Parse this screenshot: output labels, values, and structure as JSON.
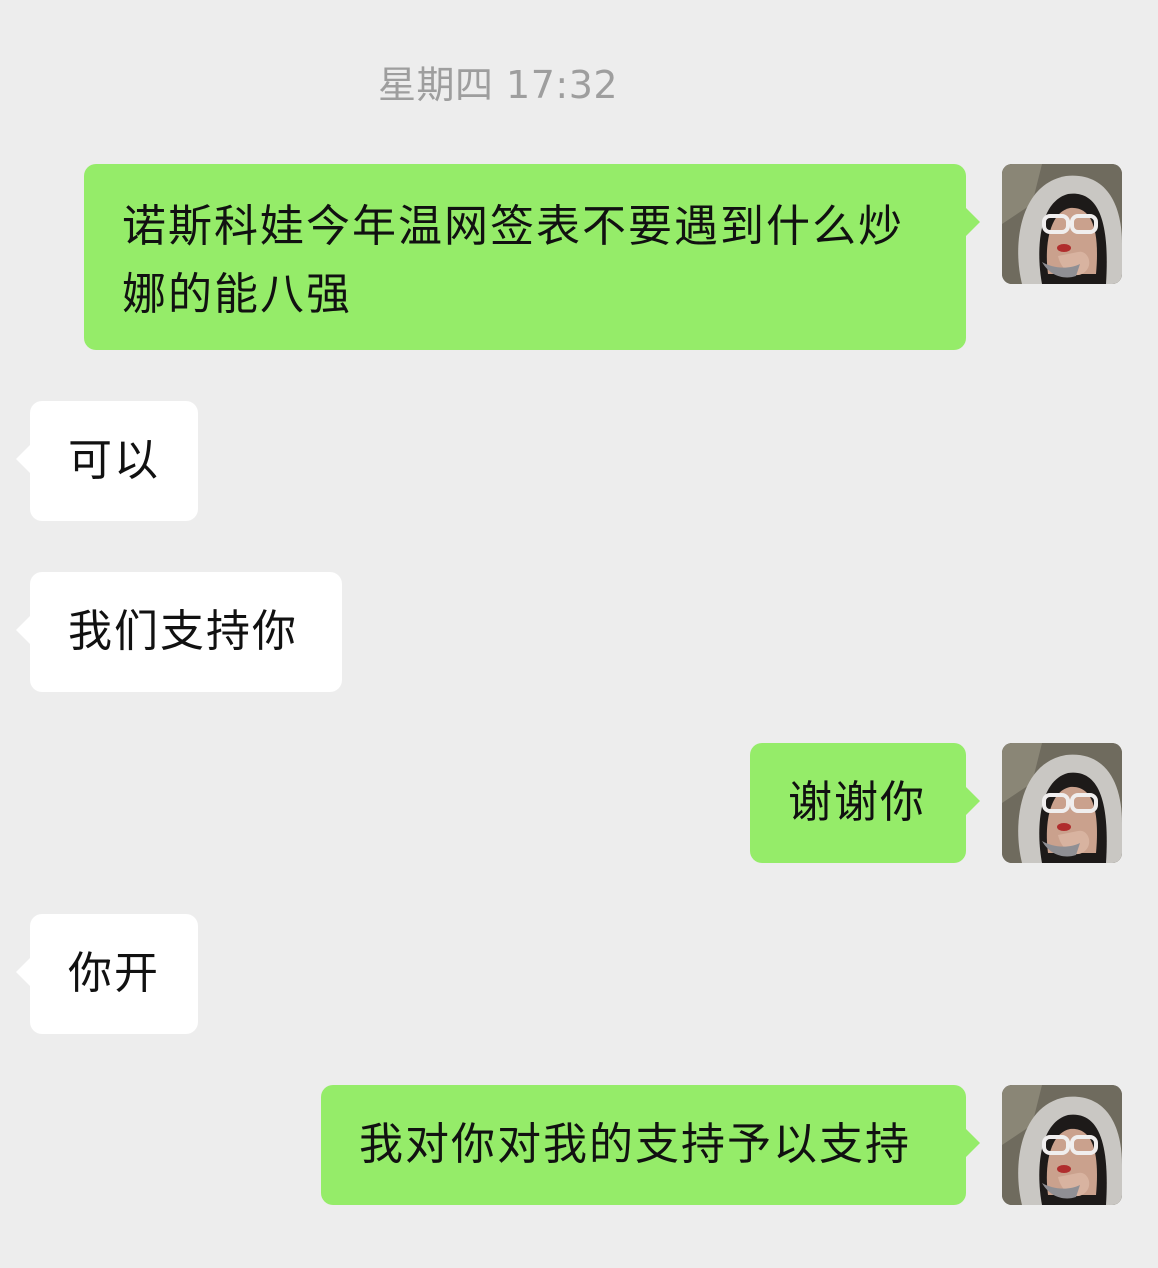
{
  "chat": {
    "timestamp": "星期四 17:32",
    "messages": [
      {
        "direction": "sent",
        "text": "诺斯科娃今年温网签表不要遇到什么炒娜的能八强"
      },
      {
        "direction": "received",
        "text": "可以"
      },
      {
        "direction": "received",
        "text": "我们支持你"
      },
      {
        "direction": "sent",
        "text": "谢谢你"
      },
      {
        "direction": "received",
        "text": "你开"
      },
      {
        "direction": "sent",
        "text": "我对你对我的支持予以支持"
      }
    ]
  },
  "colors": {
    "background": "#ededed",
    "sent_bubble": "#95ec69",
    "received_bubble": "#ffffff",
    "timestamp_text": "#9e9e9e",
    "message_text": "#111111"
  },
  "icons": {
    "avatar": "user-avatar-photo"
  }
}
